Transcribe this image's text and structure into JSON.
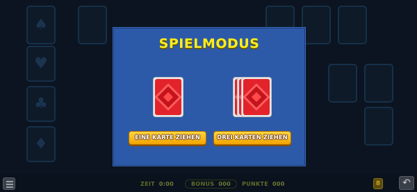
{
  "modal": {
    "title": "SPIELMODUS",
    "options": [
      {
        "label": "EINE KARTE ZIEHEN",
        "cards": 1
      },
      {
        "label": "DREI KARTEN ZIEHEN",
        "cards": 3
      }
    ]
  },
  "status_bar": {
    "time_label": "ZEIT",
    "time_value": "0:00",
    "bonus_label": "BONUS",
    "bonus_value": "000",
    "points_label": "PUNKTE",
    "points_value": "000",
    "badge_value": "8"
  },
  "colors": {
    "modal_bg": "#2c5aa8",
    "title": "#ffec1a",
    "button": "#f5b01a",
    "card_back": "#e3232b",
    "background": "#0b1420"
  },
  "icons": [
    "menu-icon",
    "undo-icon",
    "spade-icon",
    "heart-icon",
    "diamond-icon",
    "club-icon"
  ]
}
